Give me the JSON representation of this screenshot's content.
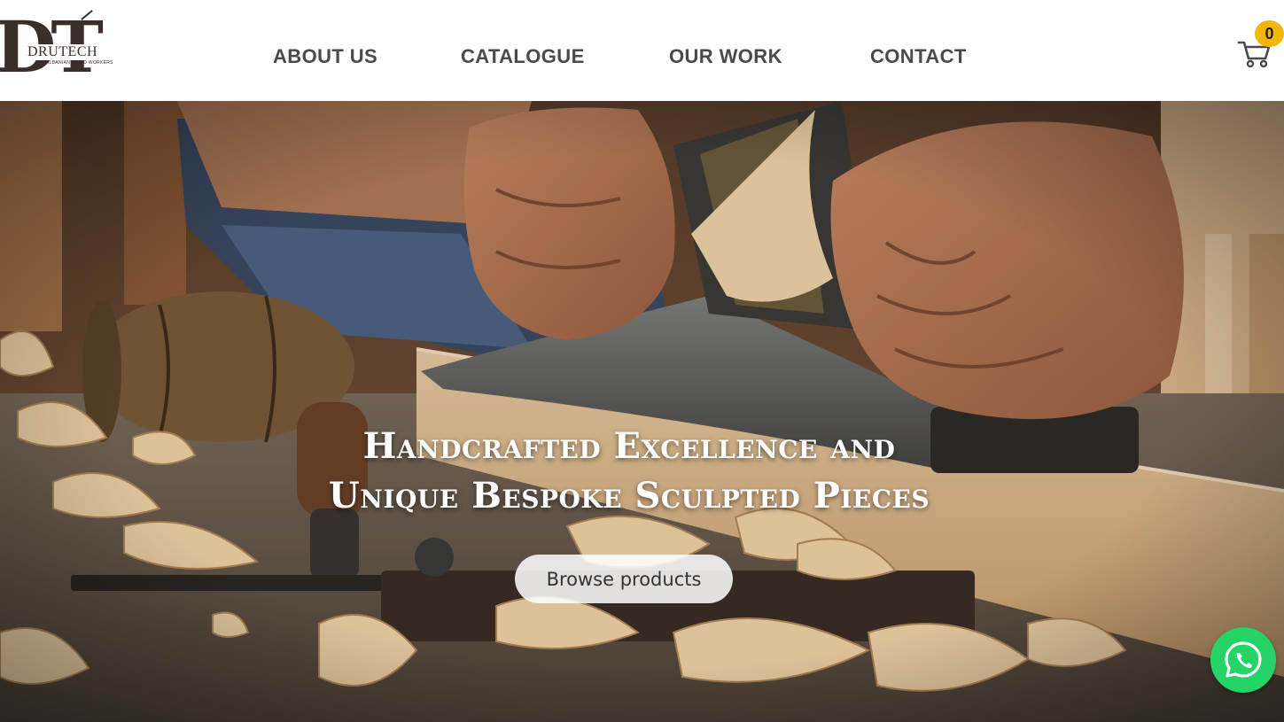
{
  "brand": {
    "monogram": "DT",
    "name": "DRUTECH",
    "tagline": "ALBANIAN WOOD WORKERS"
  },
  "nav": {
    "about": "ABOUT US",
    "catalogue": "CATALOGUE",
    "work": "OUR WORK",
    "contact": "CONTACT"
  },
  "cart": {
    "count": "0",
    "icon": "cart-icon",
    "badge_color": "#f2b705"
  },
  "hero": {
    "title_line1": "Handcrafted Excellence and",
    "title_line2": "Unique Bespoke Sculpted Pieces",
    "cta_label": "Browse products"
  },
  "whatsapp": {
    "icon": "whatsapp-icon",
    "color": "#25d366"
  }
}
